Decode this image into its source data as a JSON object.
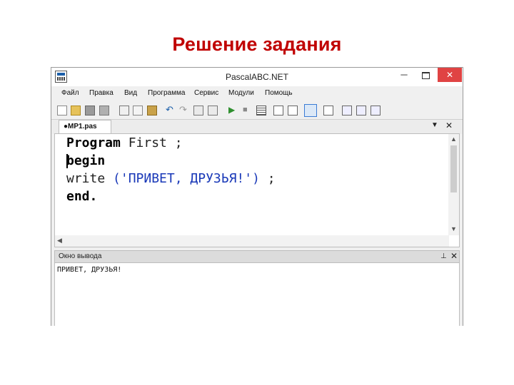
{
  "slide": {
    "title": "Решение задания"
  },
  "window": {
    "title": "PascalABC.NET",
    "minimize": "─",
    "close": "✕"
  },
  "menu": [
    "Файл",
    "Правка",
    "Вид",
    "Программа",
    "Сервис",
    "Модули",
    "Помощь"
  ],
  "toolbar": {
    "icons": [
      "new-file-icon",
      "open-folder-icon",
      "save-icon",
      "save-all-icon",
      "cut-icon",
      "copy-icon",
      "paste-icon",
      "undo-icon",
      "redo-icon",
      "find-icon",
      "replace-icon",
      "run-icon",
      "stop-icon",
      "debug-icon",
      "step-into-icon",
      "step-over-icon",
      "step-out-icon",
      "toggle-breakpoint-icon",
      "watch-icon",
      "form-designer-icon",
      "build-icon",
      "compile-icon"
    ],
    "colors": {
      "green": "#2f8f2f",
      "blue": "#1b5faa",
      "gray": "#8a8a8a",
      "yellow": "#d9a520"
    }
  },
  "editor": {
    "tab_label": "●MP1.pas",
    "dropdown": "▼",
    "close": "✕",
    "code": {
      "line1_kw": "Program",
      "line1_rest": " First ;",
      "line2_kw": "begin",
      "line3_fn": "write",
      "line3_str": " ('ПРИВЕТ, ДРУЗЬЯ!')",
      "line3_end": " ;",
      "line4_kw": "end."
    },
    "colors": {
      "keyword": "#000000",
      "string": "#1a39b8"
    }
  },
  "output": {
    "title": "Окно вывода",
    "pin": "⊥",
    "close": "✕",
    "text": "ПРИВЕТ, ДРУЗЬЯ!"
  },
  "colors": {
    "title_red": "#c00000",
    "close_red": "#e04343"
  }
}
